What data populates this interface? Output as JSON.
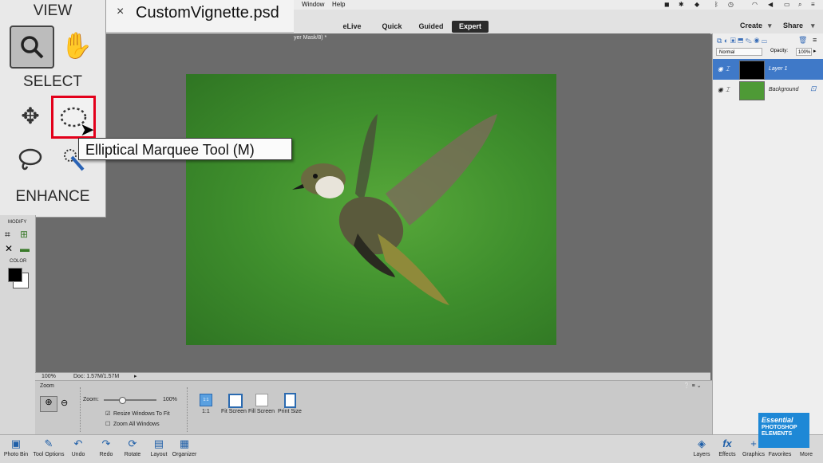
{
  "menubar": {
    "window": "Window",
    "help": "Help"
  },
  "modes": [
    "eLive",
    "Quick",
    "Guided",
    "Expert"
  ],
  "active_mode": "Expert",
  "top_buttons": {
    "create": "Create",
    "share": "Share"
  },
  "document": {
    "close_glyph": "×",
    "title": "CustomVignette.psd",
    "tab_suffix": "yer Mask/8) *"
  },
  "toolbox": {
    "view_label": "VIEW",
    "select_label": "SELECT",
    "enhance_label": "ENHANCE",
    "modify_label": "MODIFY",
    "color_label": "COLOR",
    "tooltip": "Elliptical Marquee Tool (M)"
  },
  "status": {
    "zoom": "100%",
    "doc": "Doc: 1.57M/1.57M"
  },
  "tool_options": {
    "title": "Zoom",
    "zoom_label": "Zoom:",
    "zoom_value": "100%",
    "zoom_fraction": 0.35,
    "resize_windows": "Resize Windows To Fit",
    "zoom_all": "Zoom All Windows",
    "resize_checked": true,
    "zoom_all_checked": false,
    "view_buttons": [
      {
        "glyph": "1:1",
        "label": "1:1"
      },
      {
        "glyph": "▢",
        "label": "Fit Screen"
      },
      {
        "glyph": "□",
        "label": "Fill Screen"
      },
      {
        "glyph": "▯",
        "label": "Print Size"
      }
    ]
  },
  "layers_panel": {
    "blend_mode": "Normal",
    "opacity_label": "Opacity:",
    "opacity_value": "100%",
    "layers": [
      {
        "name": "Layer 1",
        "selected": true
      },
      {
        "name": "Background",
        "selected": false
      }
    ]
  },
  "taskbar": {
    "left": [
      {
        "label": "Photo Bin",
        "icon": "photo-bin-icon",
        "glyph": "▣"
      },
      {
        "label": "Tool Options",
        "icon": "tool-options-icon",
        "glyph": "✎"
      },
      {
        "label": "Undo",
        "icon": "undo-icon",
        "glyph": "↶"
      },
      {
        "label": "Redo",
        "icon": "redo-icon",
        "glyph": "↷"
      },
      {
        "label": "Rotate",
        "icon": "rotate-icon",
        "glyph": "⟳"
      },
      {
        "label": "Layout",
        "icon": "layout-icon",
        "glyph": "▤"
      },
      {
        "label": "Organizer",
        "icon": "organizer-icon",
        "glyph": "▦"
      }
    ],
    "right": [
      {
        "label": "Layers",
        "icon": "layers-icon",
        "glyph": "◈"
      },
      {
        "label": "Effects",
        "icon": "effects-icon",
        "glyph": "fx"
      },
      {
        "label": "Graphics",
        "icon": "graphics-icon",
        "glyph": "+"
      },
      {
        "label": "Favorites",
        "icon": "favorites-icon",
        "glyph": "★"
      },
      {
        "label": "More",
        "icon": "more-icon",
        "glyph": "≡"
      }
    ]
  },
  "logo": {
    "line1": "Essential",
    "line2": "PHOTOSHOP",
    "line3": "ELEMENTS"
  },
  "colors": {
    "accent": "#3f79c8",
    "highlight": "#e3001b",
    "logo": "#1e88d6"
  }
}
